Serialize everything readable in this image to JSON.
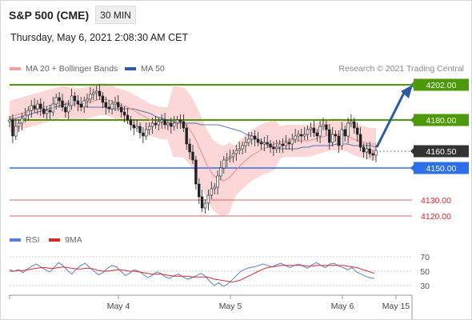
{
  "header": {
    "instrument": "S&P 500 (CME)",
    "timeframe": "30 MIN",
    "datetime": "Thursday, May 6, 2021 2:08:30 AM CET"
  },
  "legend": {
    "ma20_label": "MA 20 + Bollinger Bands",
    "ma50_label": "MA 50",
    "credit": "Research © 2021 Trading Central",
    "rsi_label": "RSI",
    "ma9_label": "9MA"
  },
  "colors": {
    "resistance": "#4c9a0c",
    "support": "#2d6fe8",
    "target_red": "#e06060",
    "ma20": "#ef8a8a",
    "ma50": "#2e5aa8",
    "bollinger_fill": "#f9c9c9",
    "candle": "#222222",
    "rsi": "#5a7fd6",
    "rsi_ma": "#d92b2b",
    "current": "#333333"
  },
  "chart_data": [
    {
      "type": "candlestick",
      "ylim": [
        4115,
        4207
      ],
      "x_labels": [
        "May 4",
        "May 5",
        "May 6",
        "May 15"
      ],
      "current_price": 4160.5,
      "levels": [
        {
          "value": 4202.0,
          "label": "4202.00",
          "kind": "resistance-target"
        },
        {
          "value": 4180.0,
          "label": "4180.00",
          "kind": "resistance"
        },
        {
          "value": 4160.5,
          "label": "4160.50",
          "kind": "current"
        },
        {
          "value": 4150.0,
          "label": "4150.00",
          "kind": "support"
        },
        {
          "value": 4130.0,
          "label": "4130.00",
          "kind": "target"
        },
        {
          "value": 4120.0,
          "label": "4120.00",
          "kind": "target"
        }
      ],
      "close_series": [
        4180,
        4170,
        4176,
        4178,
        4181,
        4183,
        4186,
        4189,
        4187,
        4190,
        4187,
        4184,
        4186,
        4185,
        4190,
        4194,
        4192,
        4188,
        4185,
        4189,
        4195,
        4192,
        4190,
        4188,
        4192,
        4193,
        4196,
        4197,
        4198,
        4195,
        4191,
        4188,
        4187,
        4190,
        4191,
        4188,
        4185,
        4183,
        4180,
        4177,
        4175,
        4176,
        4172,
        4170,
        4174,
        4176,
        4178,
        4177,
        4179,
        4180,
        4177,
        4178,
        4176,
        4178,
        4180,
        4179,
        4175,
        4165,
        4160,
        4155,
        4140,
        4132,
        4125,
        4128,
        4133,
        4137,
        4138,
        4145,
        4150,
        4155,
        4156,
        4157,
        4159,
        4161,
        4162,
        4164,
        4166,
        4168,
        4170,
        4168,
        4166,
        4165,
        4166,
        4165,
        4163,
        4162,
        4163,
        4165,
        4164,
        4166,
        4165,
        4168,
        4170,
        4171,
        4170,
        4171,
        4174,
        4175,
        4172,
        4170,
        4176,
        4177,
        4174,
        4166,
        4171,
        4170,
        4164,
        4174,
        4170,
        4178,
        4179,
        4175,
        4171,
        4163,
        4160,
        4162,
        4159,
        4158,
        4161
      ],
      "ma50_series": [
        4181,
        4181,
        4182,
        4183,
        4184,
        4185,
        4186,
        4187,
        4188,
        4189,
        4190,
        4190,
        4190,
        4189,
        4188,
        4188,
        4188,
        4188,
        4187,
        4187,
        4187,
        4187,
        4187,
        4186,
        4185,
        4184,
        4182,
        4181,
        4180,
        4179,
        4178,
        4178,
        4178,
        4178,
        4177,
        4177,
        4177,
        4177,
        4176,
        4175,
        4174,
        4173,
        4171,
        4170,
        4168,
        4166,
        4164,
        4163,
        4162,
        4162,
        4162,
        4162,
        4163,
        4163,
        4164,
        4164,
        4164,
        4164,
        4165,
        4165,
        4165,
        4164,
        4164,
        4164,
        4164,
        4163
      ],
      "ma20_series": [
        4182,
        4183,
        4184,
        4185,
        4186,
        4187,
        4188,
        4189,
        4190,
        4191,
        4191,
        4190,
        4190,
        4190,
        4191,
        4192,
        4193,
        4193,
        4192,
        4190,
        4189,
        4188,
        4186,
        4184,
        4182,
        4180,
        4179,
        4178,
        4178,
        4179,
        4179,
        4178,
        4174,
        4168,
        4160,
        4152,
        4146,
        4143,
        4142,
        4144,
        4148,
        4152,
        4155,
        4158,
        4160,
        4162,
        4163,
        4165,
        4166,
        4167,
        4167,
        4167,
        4167,
        4167,
        4168,
        4169,
        4170,
        4171,
        4171,
        4171,
        4170,
        4168,
        4167,
        4166,
        4165,
        4165
      ]
    },
    {
      "type": "line",
      "name": "RSI",
      "ylim": [
        22,
        78
      ],
      "y_ticks": [
        70,
        50,
        30
      ],
      "rsi_series": [
        52,
        50,
        52,
        48,
        53,
        57,
        60,
        56,
        52,
        49,
        55,
        62,
        58,
        51,
        46,
        53,
        58,
        61,
        55,
        50,
        45,
        48,
        54,
        58,
        56,
        50,
        44,
        47,
        52,
        50,
        46,
        41,
        44,
        49,
        47,
        42,
        40,
        44,
        46,
        42,
        39,
        41,
        44,
        47,
        43,
        36,
        30,
        34,
        29,
        32,
        38,
        44,
        50,
        53,
        55,
        56,
        58,
        60,
        58,
        56,
        59,
        61,
        58,
        55,
        58,
        60,
        57,
        54,
        59,
        62,
        58,
        55,
        60,
        61,
        57,
        55,
        52,
        55,
        49,
        46,
        43,
        41,
        40
      ],
      "ma9_series": [
        50,
        50,
        51,
        51,
        52,
        53,
        54,
        55,
        55,
        54,
        54,
        55,
        56,
        55,
        54,
        53,
        53,
        54,
        54,
        53,
        51,
        50,
        50,
        51,
        52,
        52,
        51,
        50,
        50,
        49,
        48,
        47,
        46,
        46,
        46,
        45,
        44,
        43,
        43,
        43,
        43,
        42,
        42,
        42,
        42,
        41,
        39,
        38,
        37,
        36,
        35,
        36,
        38,
        41,
        44,
        47,
        50,
        53,
        55,
        56,
        57,
        58,
        58,
        58,
        58,
        58,
        58,
        57,
        57,
        58,
        58,
        58,
        58,
        58,
        58,
        58,
        57,
        56,
        55,
        53,
        51,
        49,
        47
      ]
    }
  ]
}
